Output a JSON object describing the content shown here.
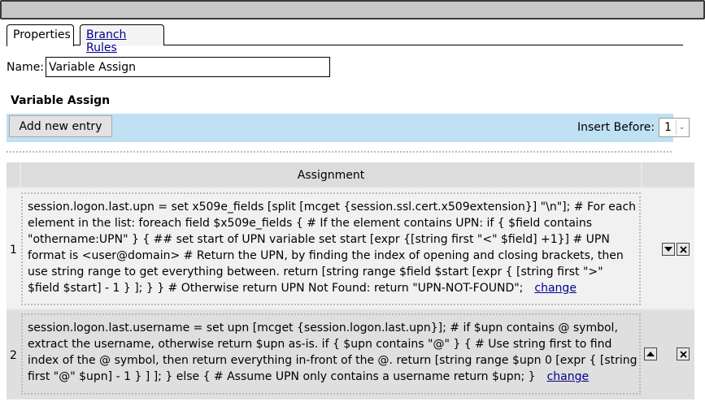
{
  "tabs": [
    {
      "label": "Properties"
    },
    {
      "label": "Branch Rules"
    }
  ],
  "name_field": {
    "label": "Name:",
    "value": "Variable Assign"
  },
  "section": {
    "title": "Variable Assign"
  },
  "toolbar": {
    "add_label": "Add new entry",
    "insert_label": "Insert Before:",
    "insert_value": "1"
  },
  "table": {
    "header": "Assignment",
    "rows": [
      {
        "num": "1",
        "text": "session.logon.last.upn = set x509e_fields [split [mcget {session.ssl.cert.x509extension}] \"\\n\"]; # For each element in the list: foreach field $x509e_fields { # If the element contains UPN: if { $field contains \"othername:UPN\" } { ## set start of UPN variable set start [expr {[string first \"<\" $field] +1}] # UPN format is <user@domain> # Return the UPN, by finding the index of opening and closing brackets, then use string range to get everything between. return [string range $field $start [expr { [string first \">\" $field $start] - 1 } ]; } } # Otherwise return UPN Not Found: return \"UPN-NOT-FOUND\";",
        "change": "change"
      },
      {
        "num": "2",
        "text": "session.logon.last.username = set upn [mcget {session.logon.last.upn}]; # if $upn contains @ symbol, extract the username, otherwise return $upn as-is. if { $upn contains \"@\" } { # Use string first to find index of the @ symbol, then return everything in-front of the @. return [string range $upn 0 [expr { [string first \"@\" $upn] - 1 } ] ]; } else { # Assume UPN only contains a username return $upn; }",
        "change": "change"
      }
    ]
  },
  "icons": {
    "move_down": "triangle-down-icon",
    "move_up": "triangle-up-icon",
    "delete": "close-icon"
  }
}
